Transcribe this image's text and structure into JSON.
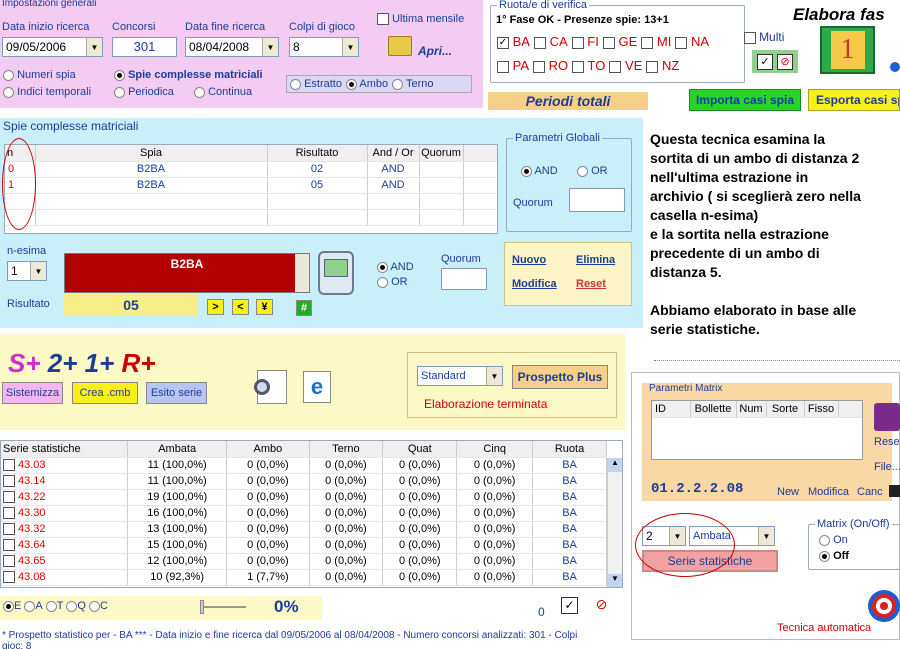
{
  "impostazioni": {
    "title": "Impostazioni generali",
    "data_inizio_label": "Data inizio ricerca",
    "data_inizio": "09/05/2006",
    "concorsi_label": "Concorsi",
    "concorsi": "301",
    "data_fine_label": "Data fine ricerca",
    "data_fine": "08/04/2008",
    "colpi_label": "Colpi di gioco",
    "colpi": "8",
    "ultima_mensile": "Ultima mensile",
    "apri": "Apri...",
    "radios": [
      "Numeri spia",
      "Spie complesse matriciali",
      "Indici temporali",
      "Periodica",
      "Continua"
    ],
    "sorte_radios": [
      "Estratto",
      "Ambo",
      "Terno"
    ]
  },
  "ruota": {
    "title": "Ruota/e di verifica",
    "fase": "1° Fase OK - Presenze spie: 13+1",
    "row1": [
      "BA",
      "CA",
      "FI",
      "GE",
      "MI",
      "NA"
    ],
    "row2": [
      "PA",
      "RO",
      "TO",
      "VE",
      "NZ"
    ],
    "multi": "Multi"
  },
  "elabora": {
    "title": "Elabora fas",
    "number": "1"
  },
  "periodi": "Periodi totali",
  "importa": "Importa casi spia",
  "esporta": "Esporta casi sp",
  "spie": {
    "title": "Spie complesse matriciali",
    "headers": [
      "n",
      "Spia",
      "Risultato",
      "And / Or",
      "Quorum"
    ],
    "rows": [
      [
        "0",
        "B2BA",
        "02",
        "AND",
        ""
      ],
      [
        "1",
        "B2BA",
        "05",
        "AND",
        ""
      ]
    ]
  },
  "param_globali": {
    "title": "Parametri Globali",
    "and": "AND",
    "or": "OR",
    "quorum": "Quorum"
  },
  "nesima": {
    "label": "n-esima",
    "value": "1",
    "spia": "B2BA",
    "risultato_label": "Risultato",
    "risultato": "05",
    "btn_gt": ">",
    "btn_lt": "<",
    "btn_y": "¥",
    "btn_hash": "#",
    "and": "AND",
    "or": "OR",
    "quorum": "Quorum"
  },
  "actions": {
    "nuovo": "Nuovo",
    "elimina": "Elimina",
    "modifica": "Modifica",
    "reset": "Reset"
  },
  "info_text": [
    "Questa tecnica esamina la",
    "sortita di un ambo di distanza 2",
    "nell'ultima estrazione in",
    "archivio ( si sceglierà zero nella",
    "casella n-esima)",
    "e la sortita nella estrazione",
    "precedente di un ambo di",
    "distanza 5.",
    "",
    "Abbiamo elaborato in base alle",
    "serie statistiche."
  ],
  "splus": {
    "s": "S+",
    "d2": "2+",
    "d1": "1+",
    "r": "R+",
    "sistemizza": "Sistemizza",
    "crea": "Crea .cmb",
    "esito": "Esito serie",
    "standard": "Standard",
    "prospetto": "Prospetto Plus",
    "status": "Elaborazione terminata"
  },
  "serie": {
    "headers": [
      "Serie statistiche",
      "Ambata",
      "Ambo",
      "Terno",
      "Quat",
      "Cinq",
      "Ruota"
    ],
    "rows": [
      [
        "43.03",
        "11 (100,0%)",
        "0 (0,0%)",
        "0 (0,0%)",
        "0 (0,0%)",
        "0 (0,0%)",
        "BA"
      ],
      [
        "43.14",
        "11 (100,0%)",
        "0 (0,0%)",
        "0 (0,0%)",
        "0 (0,0%)",
        "0 (0,0%)",
        "BA"
      ],
      [
        "43.22",
        "19 (100,0%)",
        "0 (0,0%)",
        "0 (0,0%)",
        "0 (0,0%)",
        "0 (0,0%)",
        "BA"
      ],
      [
        "43.30",
        "16 (100,0%)",
        "0 (0,0%)",
        "0 (0,0%)",
        "0 (0,0%)",
        "0 (0,0%)",
        "BA"
      ],
      [
        "43.32",
        "13 (100,0%)",
        "0 (0,0%)",
        "0 (0,0%)",
        "0 (0,0%)",
        "0 (0,0%)",
        "BA"
      ],
      [
        "43.64",
        "15 (100,0%)",
        "0 (0,0%)",
        "0 (0,0%)",
        "0 (0,0%)",
        "0 (0,0%)",
        "BA"
      ],
      [
        "43.65",
        "12 (100,0%)",
        "0 (0,0%)",
        "0 (0,0%)",
        "0 (0,0%)",
        "0 (0,0%)",
        "BA"
      ],
      [
        "43.08",
        "10 (92,3%)",
        "1 (7,7%)",
        "0 (0,0%)",
        "0 (0,0%)",
        "0 (0,0%)",
        "BA"
      ]
    ]
  },
  "bottom": {
    "radios": [
      "E",
      "A",
      "T",
      "Q",
      "C"
    ],
    "percent": "0%",
    "zero": "0",
    "footer": "* Prospetto statistico per  - BA ***  - Data inizio e fine ricerca dal 09/05/2006 al 08/04/2008 - Numero concorsi analizzati: 301 - Colpi",
    "footer2": "gioc: 8"
  },
  "matrix": {
    "title": "Parametri Matrix",
    "headers": [
      "ID",
      "Bollette",
      "Num",
      "Sorte",
      "Fisso"
    ],
    "code": "01.2.2.2.08",
    "new": "New",
    "modifica": "Modifica",
    "canc": "Canc",
    "reset": "Reset",
    "file": "File..."
  },
  "serie_ctrl": {
    "num": "2",
    "sorte": "Ambata",
    "btn": "Serie statistiche"
  },
  "matrix_onoff": {
    "title": "Matrix (On/Off)",
    "on": "On",
    "off": "Off"
  },
  "tecnica": "Tecnica automatica"
}
